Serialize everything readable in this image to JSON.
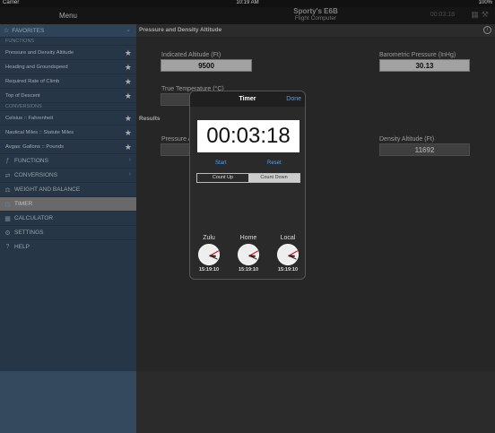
{
  "status": {
    "carrier": "Carrier",
    "time": "10:19 AM",
    "battery": "100%"
  },
  "sidebar": {
    "title": "Menu",
    "favorites_label": "FAVORITES",
    "functions_section": "FUNCTIONS",
    "functions": [
      "Pressure and Density Altitude",
      "Heading and Groundspeed",
      "Required Rate of Climb",
      "Top of Descent"
    ],
    "conversions_section": "CONVERSIONS",
    "conversions": [
      "Celsius :: Fahrenheit",
      "Nautical Miles :: Statute Miles",
      "Avgas: Gallons :: Pounds"
    ],
    "nav": [
      "FUNCTIONS",
      "CONVERSIONS",
      "WEIGHT AND BALANCE",
      "TIMER",
      "CALCULATOR",
      "SETTINGS",
      "HELP"
    ]
  },
  "header": {
    "title": "Sporty's E6B",
    "subtitle": "Flight Computer",
    "timer": "00:03:18"
  },
  "main": {
    "section_title": "Pressure and Density Altitude",
    "indicated_altitude_label": "Indicated Altitude (Ft)",
    "indicated_altitude_value": "9500",
    "barometric_label": "Barometric Pressure (InHg)",
    "barometric_value": "30.13",
    "true_temp_label": "True Temperature (°C)",
    "results_title": "Results",
    "pressure_altitude_label": "Pressure Altitude (Ft)",
    "density_altitude_label": "Density Altitude (Ft)",
    "density_altitude_value": "11692"
  },
  "timer": {
    "title": "Timer",
    "done": "Done",
    "elapsed": "00:03:18",
    "start": "Start",
    "reset": "Reset",
    "count_up": "Count Up",
    "count_down": "Count Down",
    "zones": [
      {
        "label": "Zulu",
        "time": "15:19:10"
      },
      {
        "label": "Home",
        "time": "15:19:10"
      },
      {
        "label": "Local",
        "time": "15:19:10"
      }
    ]
  }
}
